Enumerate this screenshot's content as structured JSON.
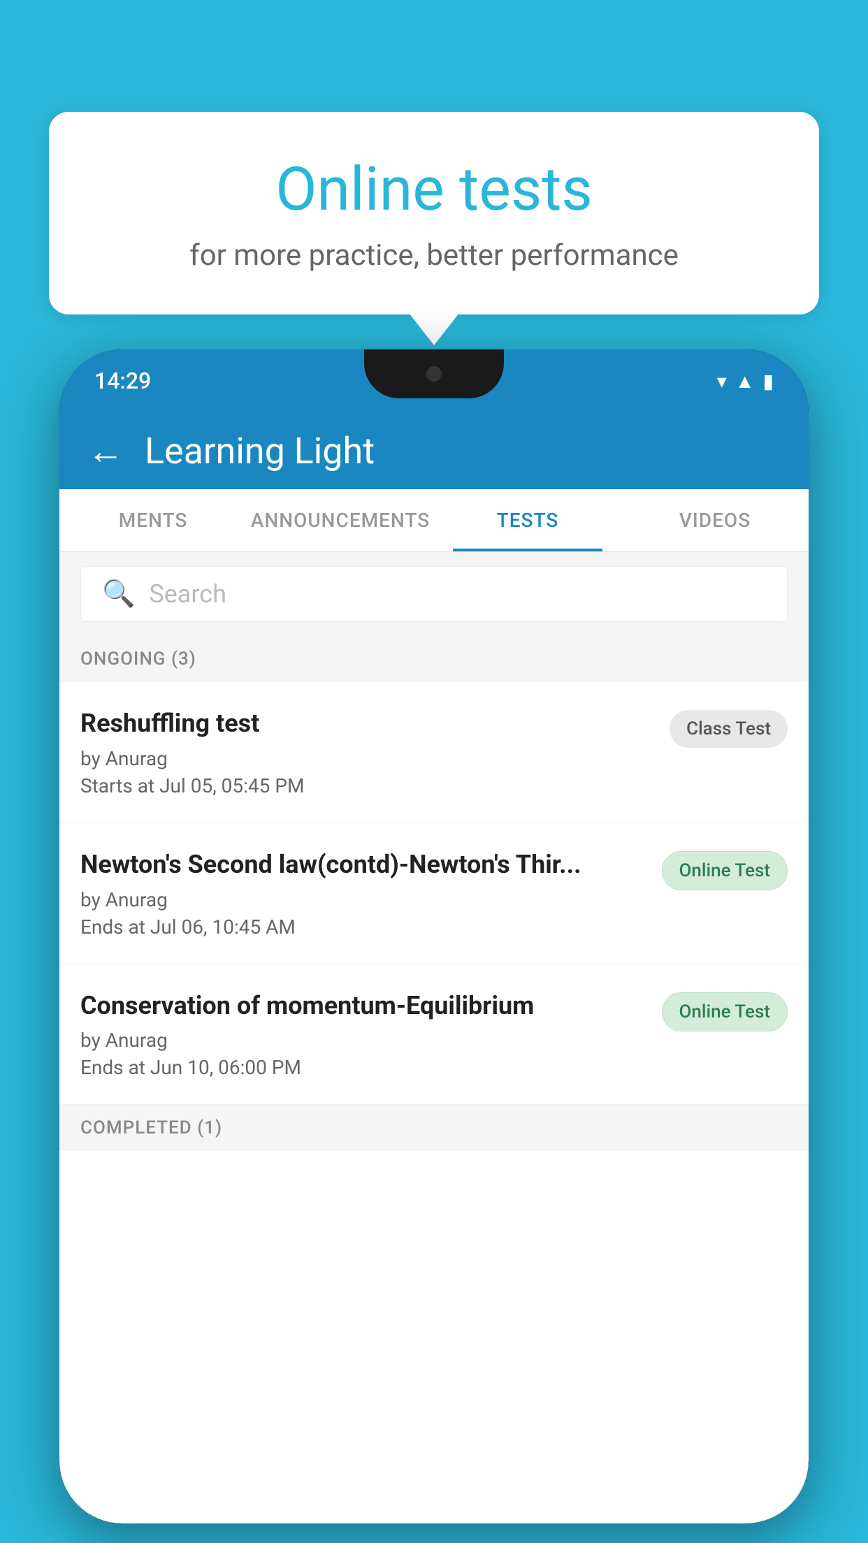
{
  "background_color": "#29B6D8",
  "speech_bubble": {
    "title": "Online tests",
    "subtitle": "for more practice, better performance"
  },
  "phone": {
    "status_bar": {
      "time": "14:29",
      "icons": [
        "wifi",
        "signal",
        "battery"
      ]
    },
    "app_bar": {
      "title": "Learning Light",
      "back_label": "←"
    },
    "tabs": [
      {
        "label": "MENTS",
        "active": false
      },
      {
        "label": "ANNOUNCEMENTS",
        "active": false
      },
      {
        "label": "TESTS",
        "active": true
      },
      {
        "label": "VIDEOS",
        "active": false
      }
    ],
    "search": {
      "placeholder": "Search"
    },
    "sections": [
      {
        "header": "ONGOING (3)",
        "items": [
          {
            "title": "Reshuffling test",
            "author": "by Anurag",
            "time_label": "Starts at",
            "time": "Jul 05, 05:45 PM",
            "badge": "Class Test",
            "badge_type": "class"
          },
          {
            "title": "Newton's Second law(contd)-Newton's Thir...",
            "author": "by Anurag",
            "time_label": "Ends at",
            "time": "Jul 06, 10:45 AM",
            "badge": "Online Test",
            "badge_type": "online"
          },
          {
            "title": "Conservation of momentum-Equilibrium",
            "author": "by Anurag",
            "time_label": "Ends at",
            "time": "Jun 10, 06:00 PM",
            "badge": "Online Test",
            "badge_type": "online"
          }
        ]
      },
      {
        "header": "COMPLETED (1)",
        "items": []
      }
    ]
  }
}
